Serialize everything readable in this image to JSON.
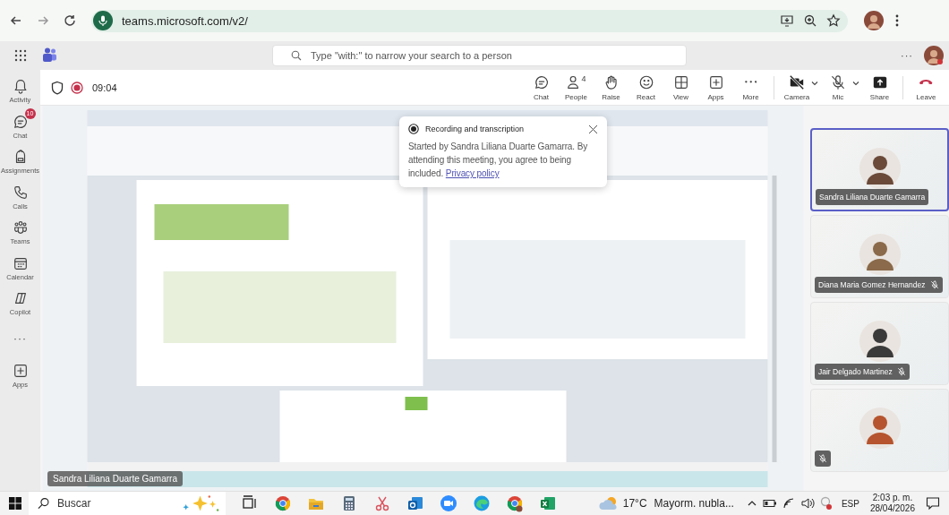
{
  "browser": {
    "url": "teams.microsoft.com/v2/"
  },
  "header": {
    "search": {
      "placeholder": "Type \"with:\" to narrow your search to a person"
    },
    "more": "···"
  },
  "rail": [
    {
      "kind": "bell",
      "label": "Activity"
    },
    {
      "kind": "chat",
      "label": "Chat",
      "badge": "10"
    },
    {
      "kind": "bag",
      "label": "Assignments"
    },
    {
      "kind": "phone",
      "label": "Calls"
    },
    {
      "kind": "teams",
      "label": "Teams"
    },
    {
      "kind": "calendar",
      "label": "Calendar"
    },
    {
      "kind": "copilot",
      "label": "Copilot"
    },
    {
      "kind": "more",
      "label": "···"
    },
    {
      "kind": "apps",
      "label": "Apps"
    }
  ],
  "meeting": {
    "time": "09:04",
    "recording": true
  },
  "toolbar": [
    {
      "kind": "chat",
      "label": "Chat"
    },
    {
      "kind": "people",
      "label": "People",
      "count": "4"
    },
    {
      "kind": "raise",
      "label": "Raise"
    },
    {
      "kind": "react",
      "label": "React"
    },
    {
      "kind": "view",
      "label": "View"
    },
    {
      "kind": "apps",
      "label": "Apps"
    },
    {
      "kind": "more",
      "label": "More"
    }
  ],
  "devices": [
    {
      "kind": "camera",
      "label": "Camera",
      "off": true
    },
    {
      "kind": "mic",
      "label": "Mic",
      "off": true
    }
  ],
  "actions": [
    {
      "kind": "share",
      "label": "Share"
    },
    {
      "kind": "leave",
      "label": "Leave"
    }
  ],
  "notification": {
    "title": "Recording and transcription",
    "text": "Started by Sandra Liliana Duarte Gamarra. By attending this meeting, you agree to being included.",
    "link": "Privacy policy"
  },
  "presenter": {
    "name": "Sandra Liliana Duarte Gamarra"
  },
  "participants": [
    {
      "name": "Sandra Liliana Duarte Gamarra",
      "muted": false,
      "selected": true
    },
    {
      "name": "Diana Maria Gomez Hernandez",
      "muted": true,
      "selected": false
    },
    {
      "name": "Jair Delgado Martinez",
      "muted": true,
      "selected": false
    },
    {
      "muted": true,
      "selected": false
    }
  ],
  "taskbar": {
    "search": {
      "placeholder": "Buscar"
    },
    "temperature": "17°C",
    "weather": "Mayorm. nubla...",
    "language": "ESP",
    "time": "2:03 p. m.",
    "date": "28/04/2026"
  }
}
